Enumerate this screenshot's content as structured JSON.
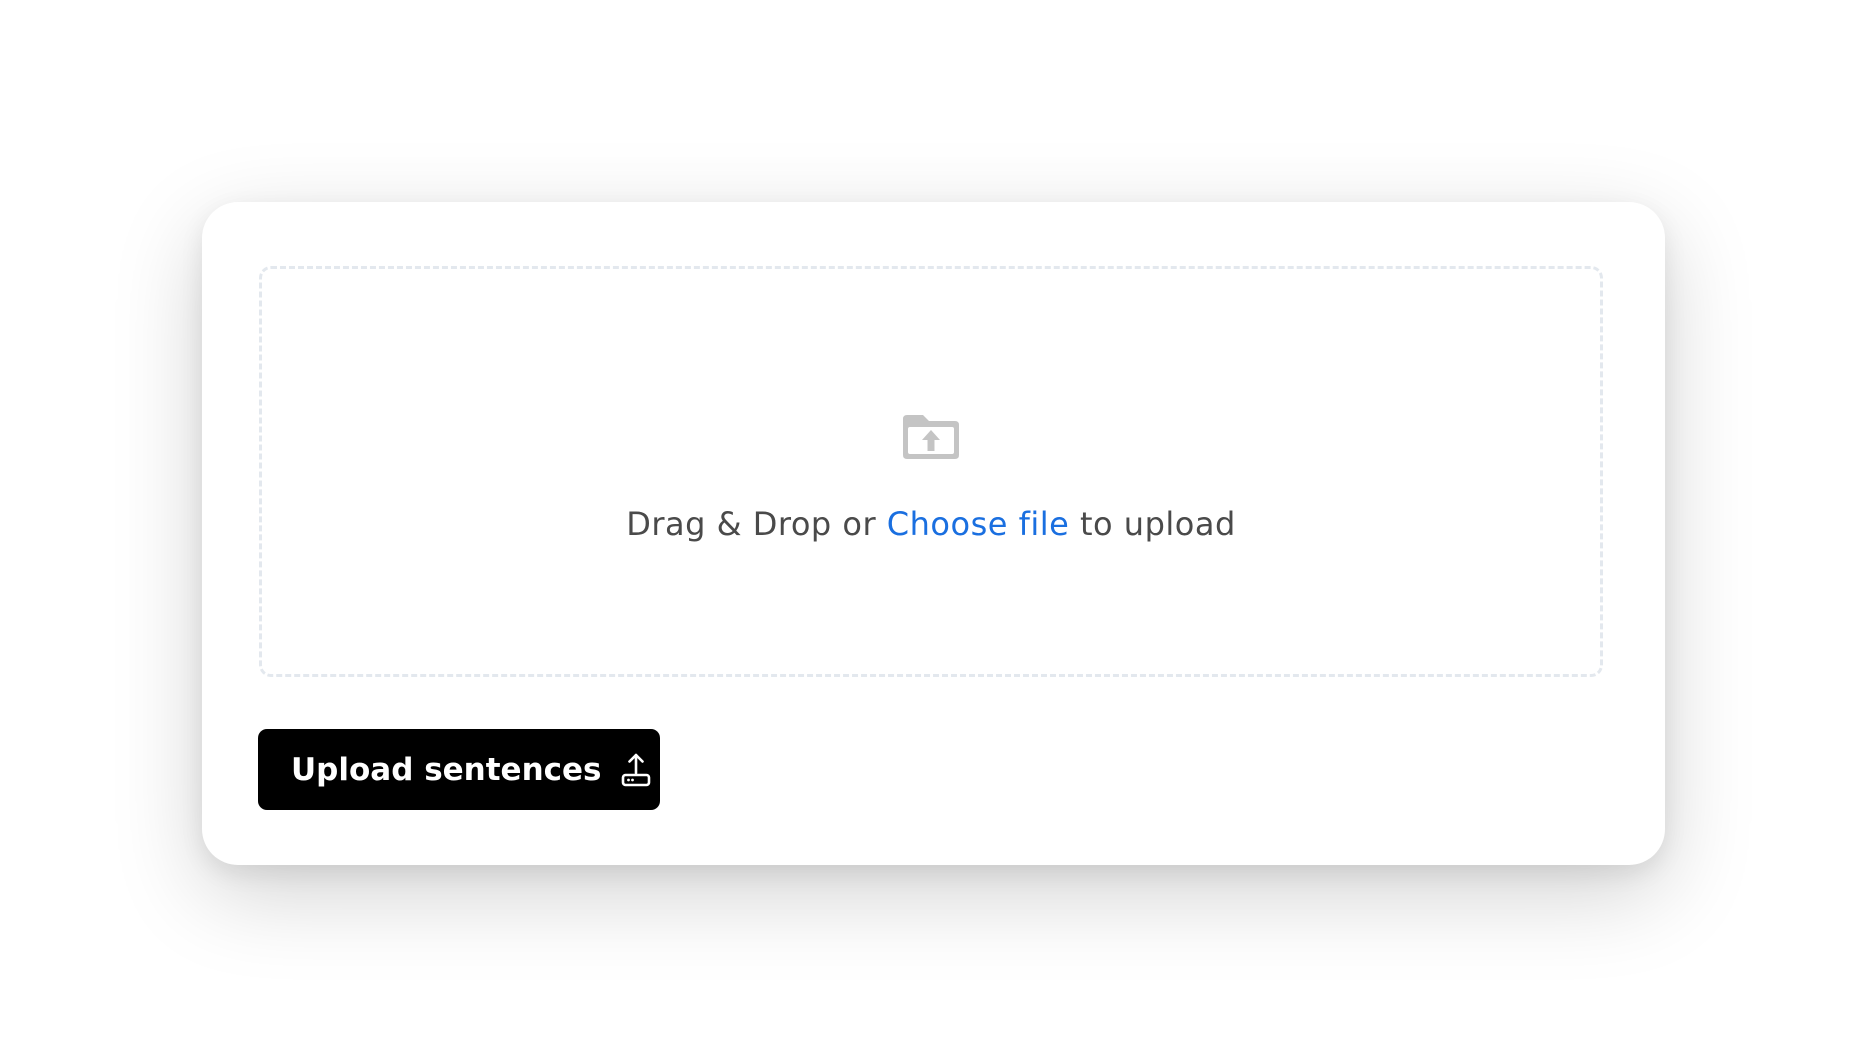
{
  "dropzone": {
    "prefix": "Drag & Drop or ",
    "link_label": "Choose file",
    "suffix": " to upload",
    "icon": "folder-upload-icon"
  },
  "upload_button": {
    "label": "Upload sentences",
    "icon": "upload-tray-icon"
  },
  "colors": {
    "link": "#1a6fe0",
    "button_bg": "#000000",
    "dropzone_border": "#e3e8ee",
    "icon_gray": "#c4c4c4"
  }
}
